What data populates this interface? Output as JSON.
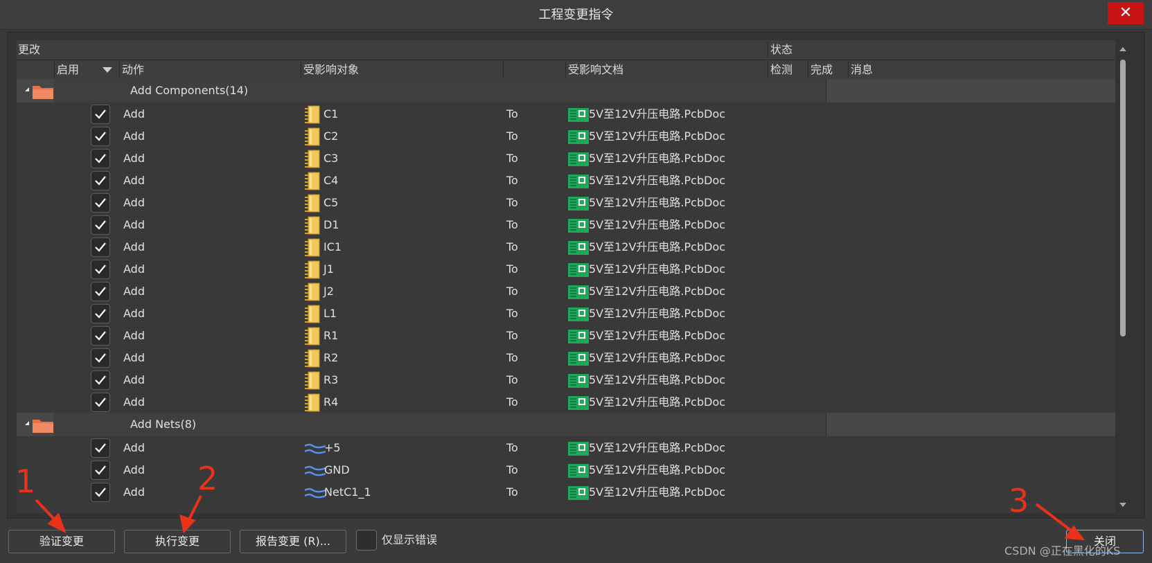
{
  "window": {
    "title": "工程变更指令",
    "close_label": "✕"
  },
  "header": {
    "group_changes": "更改",
    "group_status": "状态",
    "col_enable": "启用",
    "col_action": "动作",
    "col_affected_object": "受影响对象",
    "col_affected_doc": "受影响文档",
    "col_check": "检测",
    "col_done": "完成",
    "col_message": "消息"
  },
  "groups": [
    {
      "label": "Add Components(14)",
      "icon": "folder-icon"
    },
    {
      "label": "Add Nets(8)",
      "icon": "folder-icon"
    }
  ],
  "component_rows": [
    {
      "action": "Add",
      "object": "C1",
      "to": "To",
      "doc": "5V至12V升压电路.PcbDoc",
      "enabled": true
    },
    {
      "action": "Add",
      "object": "C2",
      "to": "To",
      "doc": "5V至12V升压电路.PcbDoc",
      "enabled": true
    },
    {
      "action": "Add",
      "object": "C3",
      "to": "To",
      "doc": "5V至12V升压电路.PcbDoc",
      "enabled": true
    },
    {
      "action": "Add",
      "object": "C4",
      "to": "To",
      "doc": "5V至12V升压电路.PcbDoc",
      "enabled": true
    },
    {
      "action": "Add",
      "object": "C5",
      "to": "To",
      "doc": "5V至12V升压电路.PcbDoc",
      "enabled": true
    },
    {
      "action": "Add",
      "object": "D1",
      "to": "To",
      "doc": "5V至12V升压电路.PcbDoc",
      "enabled": true
    },
    {
      "action": "Add",
      "object": "IC1",
      "to": "To",
      "doc": "5V至12V升压电路.PcbDoc",
      "enabled": true
    },
    {
      "action": "Add",
      "object": "J1",
      "to": "To",
      "doc": "5V至12V升压电路.PcbDoc",
      "enabled": true
    },
    {
      "action": "Add",
      "object": "J2",
      "to": "To",
      "doc": "5V至12V升压电路.PcbDoc",
      "enabled": true
    },
    {
      "action": "Add",
      "object": "L1",
      "to": "To",
      "doc": "5V至12V升压电路.PcbDoc",
      "enabled": true
    },
    {
      "action": "Add",
      "object": "R1",
      "to": "To",
      "doc": "5V至12V升压电路.PcbDoc",
      "enabled": true
    },
    {
      "action": "Add",
      "object": "R2",
      "to": "To",
      "doc": "5V至12V升压电路.PcbDoc",
      "enabled": true
    },
    {
      "action": "Add",
      "object": "R3",
      "to": "To",
      "doc": "5V至12V升压电路.PcbDoc",
      "enabled": true
    },
    {
      "action": "Add",
      "object": "R4",
      "to": "To",
      "doc": "5V至12V升压电路.PcbDoc",
      "enabled": true
    }
  ],
  "net_rows": [
    {
      "action": "Add",
      "object": "+5",
      "to": "To",
      "doc": "5V至12V升压电路.PcbDoc",
      "enabled": true
    },
    {
      "action": "Add",
      "object": "GND",
      "to": "To",
      "doc": "5V至12V升压电路.PcbDoc",
      "enabled": true
    },
    {
      "action": "Add",
      "object": "NetC1_1",
      "to": "To",
      "doc": "5V至12V升压电路.PcbDoc",
      "enabled": true
    }
  ],
  "footer": {
    "validate_label": "验证变更",
    "execute_label": "执行变更",
    "report_label": "报告变更 (R)...",
    "show_errors_label": "仅显示错误",
    "close_label": "关闭"
  },
  "annotations": {
    "one": "1",
    "two": "2",
    "three": "3"
  },
  "watermark": "CSDN @正在黑化的KS",
  "colors": {
    "close_red": "#c81414",
    "annotation_red": "#e8321c",
    "pcb_green": "#1fa85a",
    "component_gold": "#e8b84a",
    "net_blue": "#5a8ef0",
    "folder_orange": "#e8704a"
  }
}
